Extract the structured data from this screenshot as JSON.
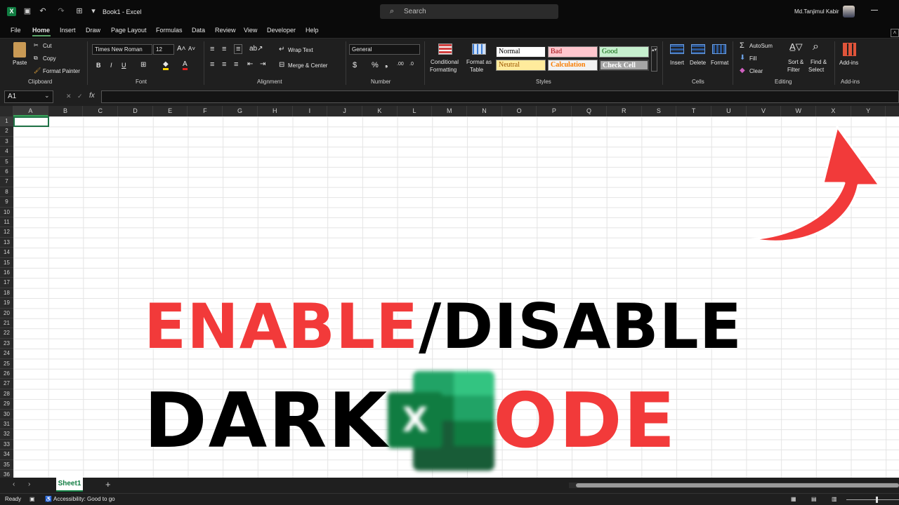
{
  "titlebar": {
    "doc_title": "Book1  -  Excel",
    "search_placeholder": "Search",
    "user_name": "Md.Tanjimul Kabir"
  },
  "menu": {
    "tabs": [
      "File",
      "Home",
      "Insert",
      "Draw",
      "Page Layout",
      "Formulas",
      "Data",
      "Review",
      "View",
      "Developer",
      "Help"
    ],
    "active": "Home"
  },
  "ribbon": {
    "clipboard": {
      "paste": "Paste",
      "cut": "Cut",
      "copy": "Copy",
      "format_painter": "Format Painter",
      "label": "Clipboard"
    },
    "font": {
      "family": "Times New Roman",
      "size": "12",
      "label": "Font",
      "bold": "B",
      "italic": "I",
      "underline": "U"
    },
    "alignment": {
      "wrap_text": "Wrap Text",
      "merge_center": "Merge & Center",
      "label": "Alignment"
    },
    "number": {
      "format": "General",
      "label": "Number",
      "currency": "$",
      "percent": "%"
    },
    "styles": {
      "conditional_formatting_1": "Conditional",
      "conditional_formatting_2": "Formatting",
      "format_as_table_1": "Format as",
      "format_as_table_2": "Table",
      "normal": "Normal",
      "bad": "Bad",
      "good": "Good",
      "neutral": "Neutral",
      "calculation": "Calculation",
      "check_cell": "Check Cell",
      "label": "Styles"
    },
    "cells": {
      "insert": "Insert",
      "delete": "Delete",
      "format": "Format",
      "label": "Cells"
    },
    "editing": {
      "autosum": "AutoSum",
      "fill": "Fill",
      "clear": "Clear",
      "sort_filter_1": "Sort &",
      "sort_filter_2": "Filter",
      "find_select_1": "Find &",
      "find_select_2": "Select",
      "label": "Editing"
    },
    "addins": {
      "button": "Add-ins",
      "label": "Add-ins"
    }
  },
  "formula_bar": {
    "name_box": "A1",
    "fx": "fx",
    "cancel": "✕",
    "enter": "✓"
  },
  "columns": [
    "A",
    "B",
    "C",
    "D",
    "E",
    "F",
    "G",
    "H",
    "I",
    "J",
    "K",
    "L",
    "M",
    "N",
    "O",
    "P",
    "Q",
    "R",
    "S",
    "T",
    "U",
    "V",
    "W",
    "X",
    "Y"
  ],
  "rows": [
    "1",
    "2",
    "3",
    "4",
    "5",
    "6",
    "7",
    "8",
    "9",
    "10",
    "11",
    "12",
    "13",
    "14",
    "15",
    "16",
    "17",
    "18",
    "19",
    "20",
    "21",
    "22",
    "23",
    "24",
    "25",
    "26",
    "27",
    "28",
    "29",
    "30",
    "31",
    "32",
    "33",
    "34",
    "35",
    "36"
  ],
  "overlay": {
    "line1_part1": "ENABLE",
    "line1_part2": "/DISABLE",
    "line2_part1": "DARK",
    "line2_part2": "MODE",
    "accent": "#f23a3a",
    "excel_green": "#107c41"
  },
  "sheet": {
    "name": "Sheet1",
    "add": "+"
  },
  "status": {
    "ready": "Ready",
    "accessibility": "Accessibility: Good to go"
  }
}
